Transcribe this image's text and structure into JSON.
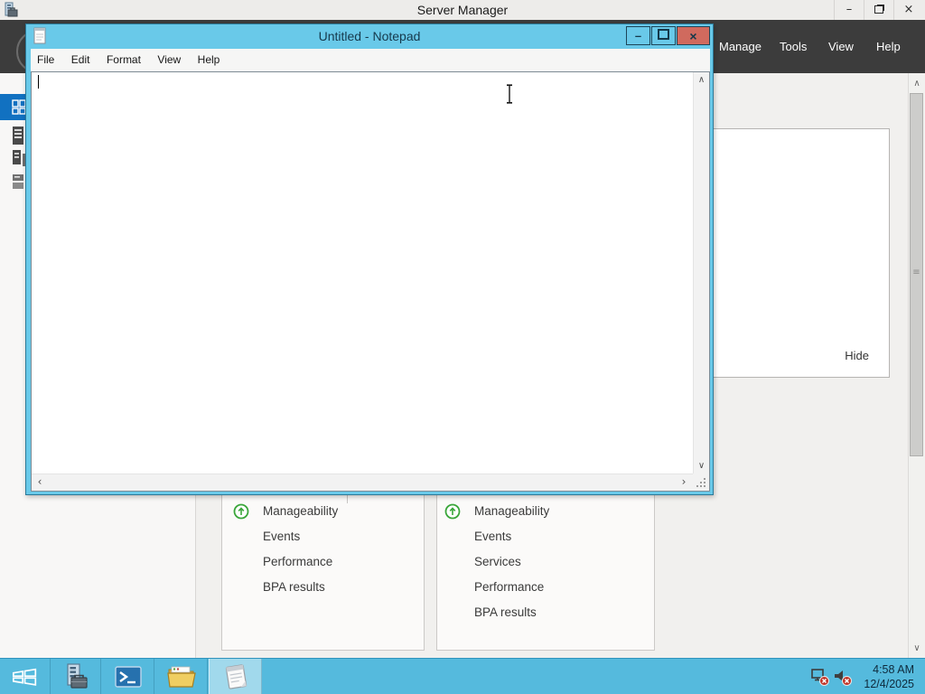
{
  "server_manager": {
    "window_title": "Server Manager",
    "menu": [
      "Manage",
      "Tools",
      "View",
      "Help"
    ],
    "flyout": {
      "hide_label": "Hide"
    },
    "tiles": [
      {
        "items": [
          "Manageability",
          "Events",
          "Performance",
          "BPA results"
        ]
      },
      {
        "items": [
          "Manageability",
          "Events",
          "Services",
          "Performance",
          "BPA results"
        ]
      }
    ]
  },
  "notepad": {
    "window_title": "Untitled - Notepad",
    "menu": [
      "File",
      "Edit",
      "Format",
      "View",
      "Help"
    ],
    "text_value": ""
  },
  "taskbar": {
    "clock": {
      "time": "4:58 AM",
      "date": "12/4/2025"
    }
  },
  "icons": {
    "minimize_glyph": "–",
    "close_glyph": "×",
    "chevron_up": "∧",
    "chevron_down": "∨",
    "chevron_left": "‹",
    "chevron_right": "›",
    "grip_glyph": "≡"
  },
  "colors": {
    "taskbar_cyan": "#55BADD",
    "notepad_chrome_cyan": "#69C9E9",
    "close_button_red": "#D06A5E",
    "command_bar_dark": "#3C3C3C",
    "selection_blue": "#1171C1",
    "status_green": "#3AA63A"
  }
}
